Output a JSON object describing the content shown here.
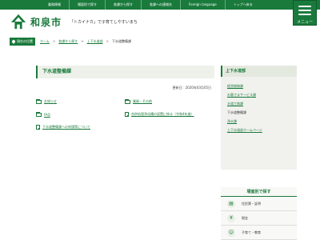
{
  "top_nav": [
    "業務情報",
    "場面別で探す",
    "各課から探す",
    "各課への連絡先",
    "Foreign language",
    "トップへ戻る"
  ],
  "menu_label": "メニュー",
  "logo": {
    "name": "和泉市",
    "tagline": "「トカイナカ」で子育てしやすいまち"
  },
  "breadcrumb": {
    "current_label": "現在の位置",
    "items": [
      "ホーム",
      "各課から探す",
      "上下水道部"
    ],
    "current": "下水道整備課"
  },
  "main": {
    "title": "下水道整備課",
    "updated": "更新日：2020年03月05日",
    "links": [
      [
        {
          "icon": "folder-icon",
          "label": "お知らせ"
        },
        {
          "icon": "folder-icon",
          "label": "業務・その他"
        }
      ],
      [
        {
          "icon": "folder-icon",
          "label": "FAQ"
        },
        {
          "icon": "doc-icon",
          "label": "合併処理浄化槽の設置に係る（令和4年度）"
        }
      ],
      [
        {
          "icon": "doc-icon",
          "label": "下水道整備課への申請等について"
        }
      ]
    ]
  },
  "side": {
    "title": "上下水道部",
    "items": [
      "経営総務課",
      "お客さまサービス課",
      "水道工務課",
      "下水道整備課",
      "浄水課",
      "上下水道部ホームページ"
    ],
    "current_index": 3
  },
  "purpose": {
    "title": "場面別で探す",
    "items": [
      {
        "icon": "certificate-icon",
        "label": "住民票・証明"
      },
      {
        "icon": "tax-icon",
        "label": "税金"
      },
      {
        "icon": "child-icon",
        "label": "子育て・教育"
      }
    ]
  },
  "colors": {
    "brand": "#1a7a3c"
  }
}
